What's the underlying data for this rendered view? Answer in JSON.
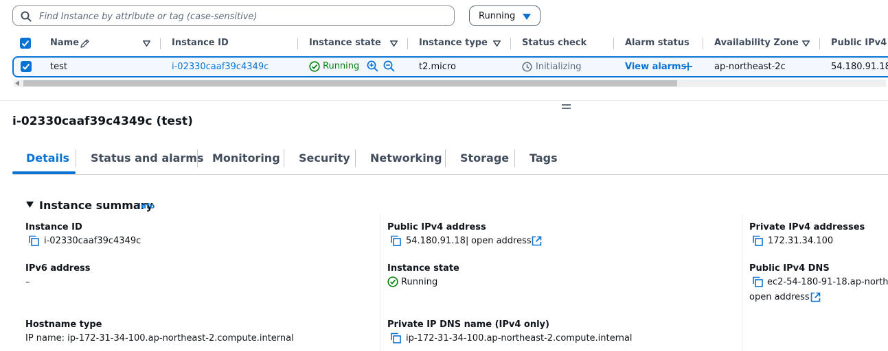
{
  "filter": {
    "search_placeholder": "Find Instance by attribute or tag (case-sensitive)",
    "state_value": "Running"
  },
  "table": {
    "headers": [
      "Name",
      "Instance ID",
      "Instance state",
      "Instance type",
      "Status check",
      "Alarm status",
      "Availability Zone",
      "Public IPv4 ..."
    ],
    "row": {
      "name": "test",
      "instance_id": "i-02330caaf39c4349c",
      "state": "Running",
      "type": "t2.micro",
      "status_check": "Initializing",
      "alarm": "View alarms",
      "az": "ap-northeast-2c",
      "public_ipv4": "54.180.91.18"
    }
  },
  "details": {
    "title": "i-02330caaf39c4349c (test)",
    "tabs": [
      "Details",
      "Status and alarms",
      "Monitoring",
      "Security",
      "Networking",
      "Storage",
      "Tags"
    ],
    "summary_title": "Instance summary",
    "info": "Info",
    "fields": {
      "instance_id_label": "Instance ID",
      "instance_id_value": "i-02330caaf39c4349c",
      "ipv6_label": "IPv6 address",
      "ipv6_value": "–",
      "hostname_type_label": "Hostname type",
      "hostname_type_value": "IP name: ip-172-31-34-100.ap-northeast-2.compute.internal",
      "public_ipv4_label": "Public IPv4 address",
      "public_ipv4_value": "54.180.91.18",
      "public_ipv4_sep": "|",
      "open_address": "open address",
      "instance_state_label": "Instance state",
      "instance_state_value": "Running",
      "private_dns_label": "Private IP DNS name (IPv4 only)",
      "private_dns_value": "ip-172-31-34-100.ap-northeast-2.compute.internal",
      "private_ipv4_label": "Private IPv4 addresses",
      "private_ipv4_value": "172.31.34.100",
      "public_dns_label": "Public IPv4 DNS",
      "public_dns_value": "ec2-54-180-91-18.ap-north",
      "public_dns_open": "open address"
    }
  },
  "colors": {
    "accent": "#0972d3",
    "success": "#037f0c",
    "muted": "#5f6b7a"
  }
}
